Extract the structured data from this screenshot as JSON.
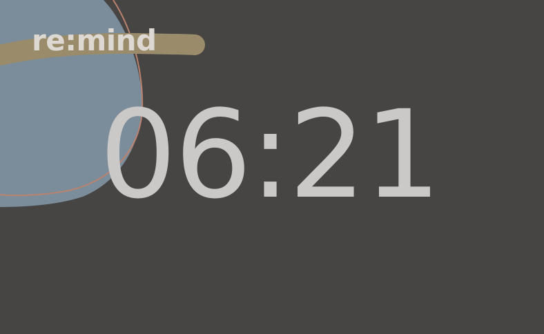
{
  "app": {
    "brand_name": "re:mind"
  },
  "clock": {
    "time": "06:21"
  },
  "colors": {
    "background": "#474544",
    "blob_fill": "#7b8c9a",
    "blob_outline": "#b98370",
    "brush_stroke": "#9a8c6a",
    "brand_text": "#ddd8d2",
    "clock_text": "#cbc9c8"
  }
}
